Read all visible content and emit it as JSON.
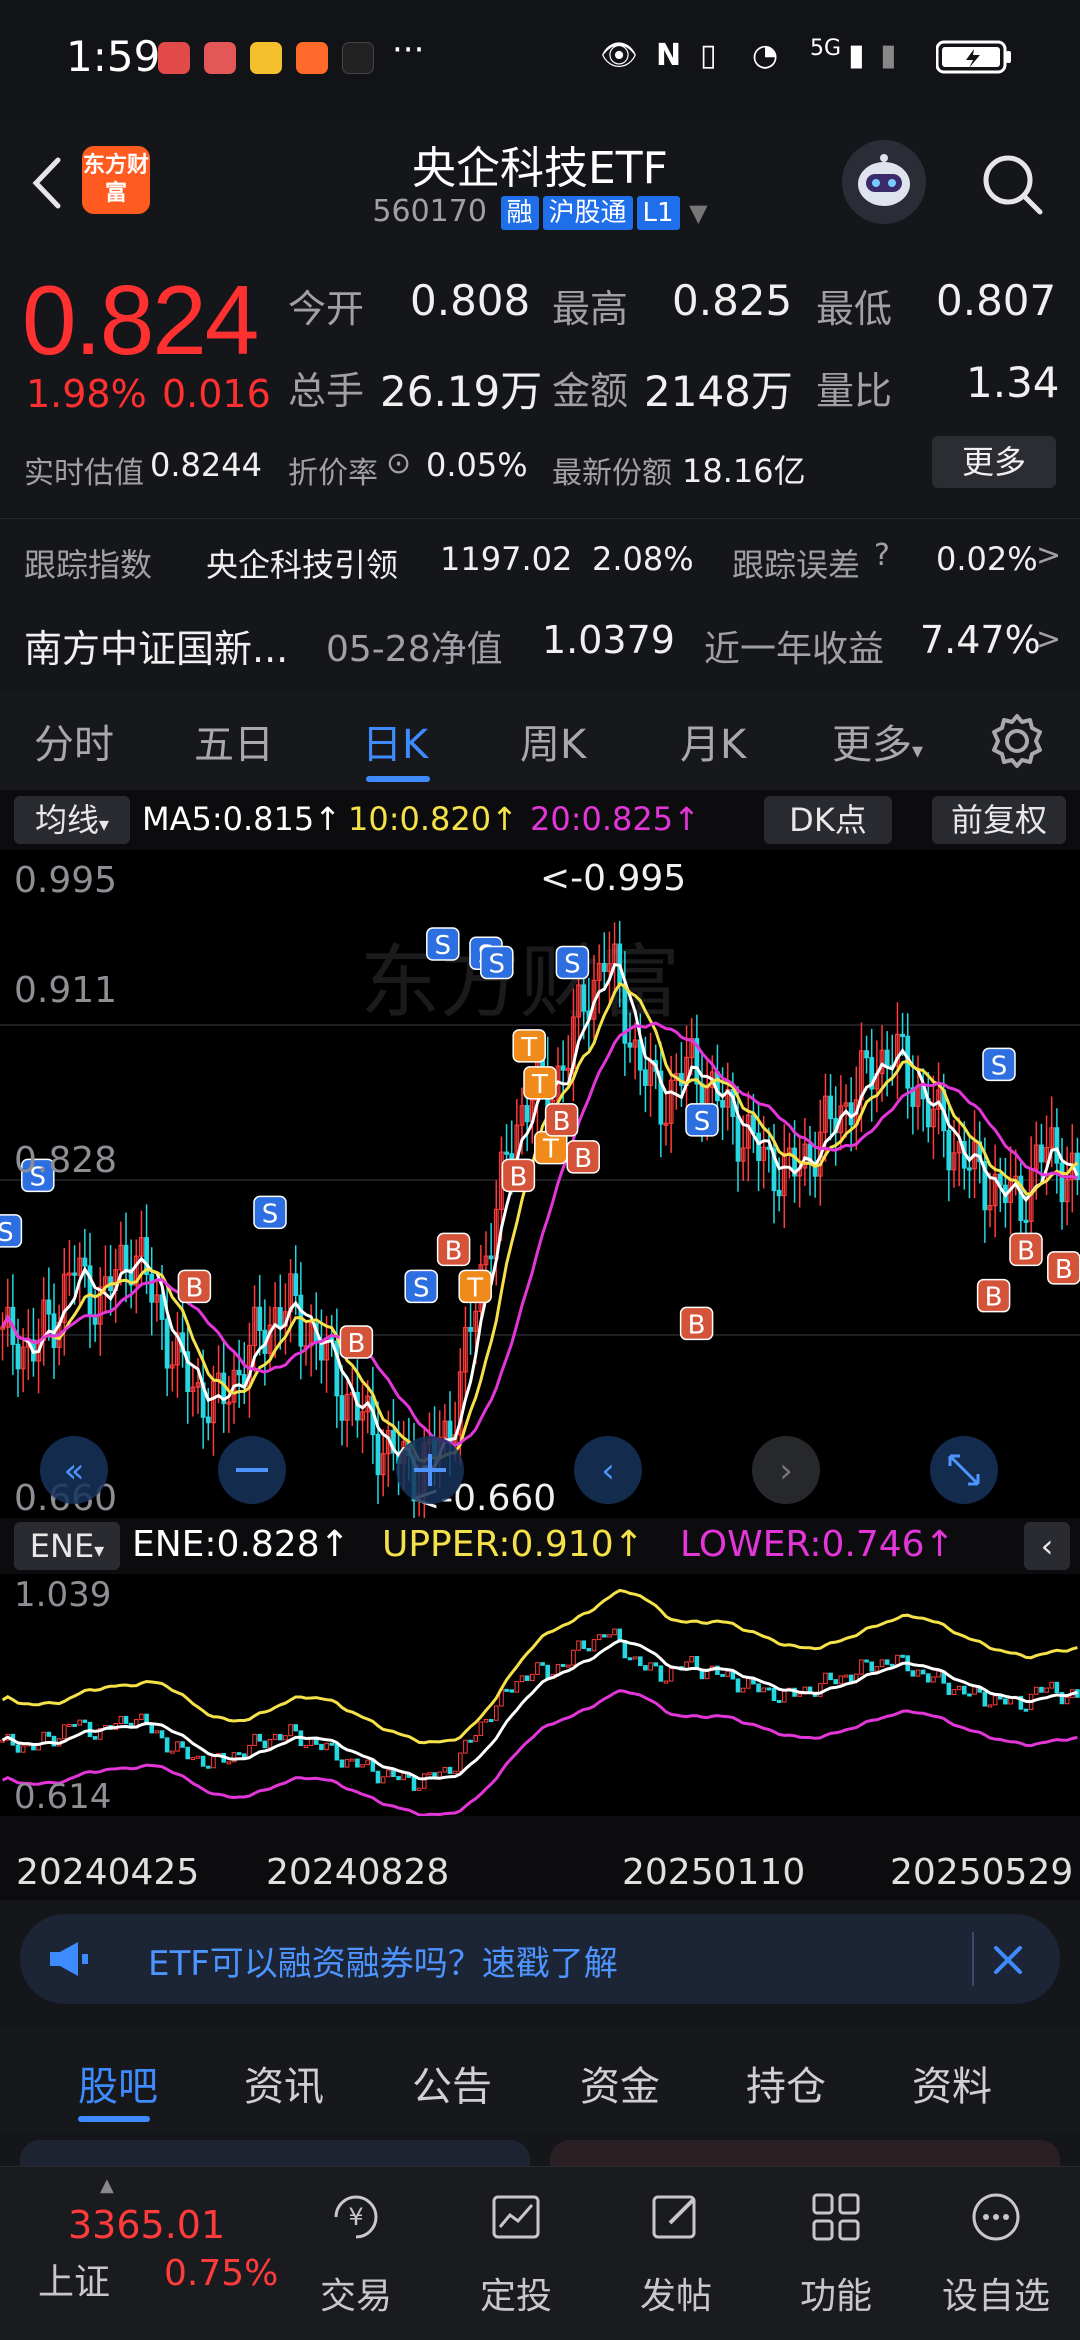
{
  "status_bar": {
    "time": "1:59",
    "dots": "···",
    "network": "5G"
  },
  "header": {
    "title": "央企科技ETF",
    "code": "560170",
    "tags": [
      "融",
      "沪股通",
      "L1"
    ],
    "logo_text": "东方财富"
  },
  "quote": {
    "price": "0.824",
    "change_pct": "1.98%",
    "change_amt": "0.016",
    "open_label": "今开",
    "open": "0.808",
    "high_label": "最高",
    "high": "0.825",
    "low_label": "最低",
    "low": "0.807",
    "volume_label": "总手",
    "volume": "26.19万",
    "amount_label": "金额",
    "amount": "2148万",
    "ratio_label": "量比",
    "ratio": "1.34",
    "iopv_label": "实时估值",
    "iopv": "0.8244",
    "discount_label": "折价率",
    "discount": "0.05%",
    "shares_label": "最新份额",
    "shares": "18.16亿",
    "more_label": "更多"
  },
  "tracking": {
    "label": "跟踪指数",
    "index_name": "央企科技引领",
    "index_value": "1197.02",
    "index_pct": "2.08%",
    "error_label": "跟踪误差",
    "error_value": "0.02%"
  },
  "fund": {
    "name": "南方中证国新...",
    "nav_label": "05-28净值",
    "nav": "1.0379",
    "return_label": "近一年收益",
    "return": "7.47%"
  },
  "tabs": [
    "分时",
    "五日",
    "日K",
    "周K",
    "月K",
    "更多"
  ],
  "active_tab": 2,
  "ma_row": {
    "indicator": "均线",
    "ma5": "MA5:0.815↑",
    "ma10": "10:0.820↑",
    "ma20": "20:0.825↑",
    "dk_btn": "DK点",
    "adjust_btn": "前复权"
  },
  "ene_row": {
    "indicator": "ENE",
    "ene": "ENE:0.828↑",
    "upper": "UPPER:0.910↑",
    "lower": "LOWER:0.746↑"
  },
  "chart_data": {
    "type": "candlestick",
    "y_axis_labels": [
      "0.995",
      "0.911",
      "0.828",
      "0.660"
    ],
    "high_marker": "<-0.995",
    "low_marker": "<-0.660",
    "ene_axis_labels": [
      "1.039",
      "0.614"
    ],
    "x_labels": [
      "20240425",
      "20240828",
      "20250110",
      "20250529"
    ],
    "ylim": [
      0.66,
      0.995
    ],
    "colors": {
      "up": "#ff3b3b",
      "down": "#24d7e0",
      "ma5": "#ffffff",
      "ma10": "#f5e14a",
      "ma20": "#e336d8"
    },
    "close_path": [
      0.74,
      0.745,
      0.73,
      0.75,
      0.76,
      0.78,
      0.77,
      0.76,
      0.78,
      0.79,
      0.775,
      0.755,
      0.73,
      0.72,
      0.71,
      0.705,
      0.72,
      0.73,
      0.745,
      0.755,
      0.76,
      0.75,
      0.74,
      0.725,
      0.71,
      0.7,
      0.69,
      0.68,
      0.675,
      0.67,
      0.68,
      0.69,
      0.72,
      0.76,
      0.8,
      0.83,
      0.86,
      0.88,
      0.87,
      0.89,
      0.91,
      0.93,
      0.95,
      0.93,
      0.9,
      0.88,
      0.87,
      0.88,
      0.89,
      0.88,
      0.87,
      0.86,
      0.85,
      0.84,
      0.835,
      0.83,
      0.84,
      0.85,
      0.86,
      0.87,
      0.88,
      0.89,
      0.9,
      0.885,
      0.875,
      0.86,
      0.85,
      0.84,
      0.83,
      0.825,
      0.82,
      0.815,
      0.835,
      0.845,
      0.835,
      0.824
    ]
  },
  "banner": {
    "text": "ETF可以融资融券吗？速戳了解"
  },
  "sections": [
    "股吧",
    "资讯",
    "公告",
    "资金",
    "持仓",
    "资料"
  ],
  "bottom_nav": {
    "index_value": "3365.01",
    "index_name": "上证",
    "index_pct": "0.75%",
    "items": [
      "交易",
      "定投",
      "发帖",
      "功能",
      "设自选"
    ]
  }
}
